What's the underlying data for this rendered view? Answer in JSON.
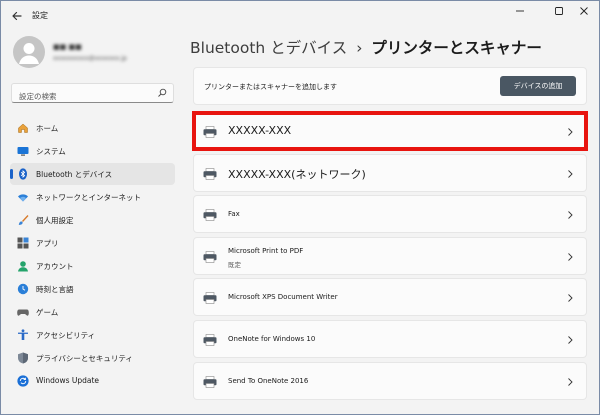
{
  "window": {
    "app_title": "設定",
    "back_icon": "back-arrow-icon",
    "controls": [
      "minimize-icon",
      "maximize-icon",
      "close-icon"
    ]
  },
  "user": {
    "name": "■■ ■■",
    "email": "xxxxxxxxxx@xxxxxxx.jp"
  },
  "search": {
    "placeholder": "設定の検索",
    "icon": "search-icon"
  },
  "sidebar": {
    "items": [
      {
        "label": "ホーム",
        "icon": "home-icon",
        "active": false
      },
      {
        "label": "システム",
        "icon": "system-icon",
        "active": false
      },
      {
        "label": "Bluetooth とデバイス",
        "icon": "bluetooth-icon",
        "active": true
      },
      {
        "label": "ネットワークとインターネット",
        "icon": "wifi-icon",
        "active": false
      },
      {
        "label": "個人用設定",
        "icon": "brush-icon",
        "active": false
      },
      {
        "label": "アプリ",
        "icon": "apps-icon",
        "active": false
      },
      {
        "label": "アカウント",
        "icon": "account-icon",
        "active": false
      },
      {
        "label": "時刻と言語",
        "icon": "time-language-icon",
        "active": false
      },
      {
        "label": "ゲーム",
        "icon": "game-icon",
        "active": false
      },
      {
        "label": "アクセシビリティ",
        "icon": "accessibility-icon",
        "active": false
      },
      {
        "label": "プライバシーとセキュリティ",
        "icon": "shield-icon",
        "active": false
      },
      {
        "label": "Windows Update",
        "icon": "windows-update-icon",
        "active": false
      }
    ]
  },
  "breadcrumb": {
    "root": "Bluetooth とデバイス",
    "separator": "›",
    "current": "プリンターとスキャナー"
  },
  "add_device": {
    "text": "プリンターまたはスキャナーを追加します",
    "button": "デバイスの追加"
  },
  "printers": [
    {
      "name": "XXXXX-XXX",
      "sub": ""
    },
    {
      "name": "XXXXX-XXX(ネットワーク)",
      "sub": ""
    },
    {
      "name": "Fax",
      "sub": ""
    },
    {
      "name": "Microsoft Print to PDF",
      "sub": "既定"
    },
    {
      "name": "Microsoft XPS Document Writer",
      "sub": ""
    },
    {
      "name": "OneNote for Windows 10",
      "sub": ""
    },
    {
      "name": "Send To OneNote 2016",
      "sub": ""
    }
  ],
  "colors": {
    "accent": "#1a62c9",
    "highlight": "#e8140f",
    "button": "#4a5763",
    "window_bg": "#f3f3f3",
    "card_bg": "#fbfbfb"
  }
}
